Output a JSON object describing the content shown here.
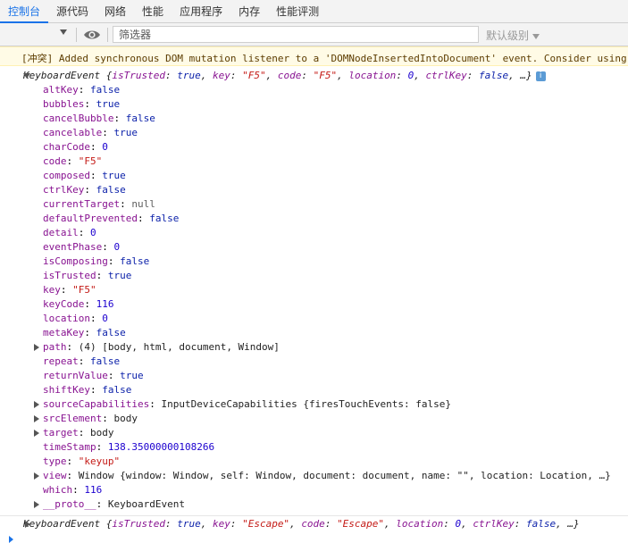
{
  "tabs": [
    "控制台",
    "源代码",
    "网络",
    "性能",
    "应用程序",
    "内存",
    "性能评测"
  ],
  "toolbar": {
    "filter_placeholder": "筛选器",
    "levels_label": "默认级别"
  },
  "warning": {
    "tag": "[冲突]",
    "message": " Added synchronous DOM mutation listener to a 'DOMNodeInsertedIntoDocument' event. Consider using"
  },
  "event1": {
    "header_type": "KeyboardEvent",
    "header_open": " {",
    "h_isTrusted_k": "isTrusted",
    "h_isTrusted_v": "true",
    "h_key_k": "key",
    "h_key_v": "\"F5\"",
    "h_code_k": "code",
    "h_code_v": "\"F5\"",
    "h_location_k": "location",
    "h_location_v": "0",
    "h_ctrlKey_k": "ctrlKey",
    "h_ctrlKey_v": "false",
    "h_tail": ", …}",
    "info": "i",
    "props": [
      {
        "k": "altKey",
        "v": "false",
        "t": "bool",
        "exp": false
      },
      {
        "k": "bubbles",
        "v": "true",
        "t": "bool",
        "exp": false
      },
      {
        "k": "cancelBubble",
        "v": "false",
        "t": "bool",
        "exp": false
      },
      {
        "k": "cancelable",
        "v": "true",
        "t": "bool",
        "exp": false
      },
      {
        "k": "charCode",
        "v": "0",
        "t": "num",
        "exp": false
      },
      {
        "k": "code",
        "v": "\"F5\"",
        "t": "str",
        "exp": false
      },
      {
        "k": "composed",
        "v": "true",
        "t": "bool",
        "exp": false
      },
      {
        "k": "ctrlKey",
        "v": "false",
        "t": "bool",
        "exp": false
      },
      {
        "k": "currentTarget",
        "v": "null",
        "t": "nul",
        "exp": false
      },
      {
        "k": "defaultPrevented",
        "v": "false",
        "t": "bool",
        "exp": false
      },
      {
        "k": "detail",
        "v": "0",
        "t": "num",
        "exp": false
      },
      {
        "k": "eventPhase",
        "v": "0",
        "t": "num",
        "exp": false
      },
      {
        "k": "isComposing",
        "v": "false",
        "t": "bool",
        "exp": false
      },
      {
        "k": "isTrusted",
        "v": "true",
        "t": "bool",
        "exp": false
      },
      {
        "k": "key",
        "v": "\"F5\"",
        "t": "str",
        "exp": false
      },
      {
        "k": "keyCode",
        "v": "116",
        "t": "num",
        "exp": false
      },
      {
        "k": "location",
        "v": "0",
        "t": "num",
        "exp": false
      },
      {
        "k": "metaKey",
        "v": "false",
        "t": "bool",
        "exp": false
      },
      {
        "k": "path",
        "v": "(4) [body, html, document, Window]",
        "t": "obj",
        "exp": true
      },
      {
        "k": "repeat",
        "v": "false",
        "t": "bool",
        "exp": false
      },
      {
        "k": "returnValue",
        "v": "true",
        "t": "bool",
        "exp": false
      },
      {
        "k": "shiftKey",
        "v": "false",
        "t": "bool",
        "exp": false
      },
      {
        "k": "sourceCapabilities",
        "v": "InputDeviceCapabilities {firesTouchEvents: false}",
        "t": "obj",
        "exp": true
      },
      {
        "k": "srcElement",
        "v": "body",
        "t": "obj",
        "exp": true
      },
      {
        "k": "target",
        "v": "body",
        "t": "obj",
        "exp": true
      },
      {
        "k": "timeStamp",
        "v": "138.35000000108266",
        "t": "num",
        "exp": false
      },
      {
        "k": "type",
        "v": "\"keyup\"",
        "t": "str",
        "exp": false
      },
      {
        "k": "view",
        "v": "Window {window: Window, self: Window, document: document, name: \"\", location: Location, …}",
        "t": "obj",
        "exp": true
      },
      {
        "k": "which",
        "v": "116",
        "t": "num",
        "exp": false
      },
      {
        "k": "__proto__",
        "v": "KeyboardEvent",
        "t": "obj",
        "exp": true
      }
    ]
  },
  "event2": {
    "header_type": "KeyboardEvent",
    "header_open": " {",
    "h_isTrusted_k": "isTrusted",
    "h_isTrusted_v": "true",
    "h_key_k": "key",
    "h_key_v": "\"Escape\"",
    "h_code_k": "code",
    "h_code_v": "\"Escape\"",
    "h_location_k": "location",
    "h_location_v": "0",
    "h_ctrlKey_k": "ctrlKey",
    "h_ctrlKey_v": "false",
    "h_tail": ", …}"
  },
  "colors": {
    "accent": "#1a73e8",
    "key": "#881391",
    "string": "#c41a16",
    "number": "#1c00cf",
    "warning_bg": "#fffbe6"
  }
}
